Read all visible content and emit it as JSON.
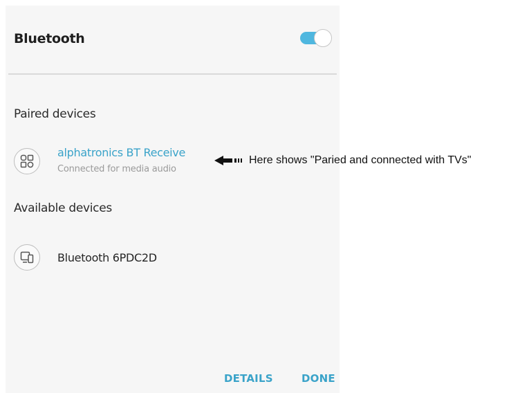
{
  "header": {
    "title": "Bluetooth",
    "toggle_on": true
  },
  "paired": {
    "section_title": "Paired devices",
    "device": {
      "name": "alphatronics BT Receive",
      "status": "Connected for media audio",
      "icon": "multi-device-icon"
    }
  },
  "available": {
    "section_title": "Available devices",
    "device": {
      "name": "Bluetooth 6PDC2D",
      "icon": "devices-icon"
    }
  },
  "footer": {
    "details_label": "DETAILS",
    "done_label": "DONE"
  },
  "annotation": {
    "text": "Here shows \"Paried and connected with TVs\"",
    "icon": "arrow-left-icon"
  },
  "colors": {
    "accent": "#3aa3c9",
    "toggle_track": "#4fb7df",
    "panel_background": "#f6f6f6"
  }
}
